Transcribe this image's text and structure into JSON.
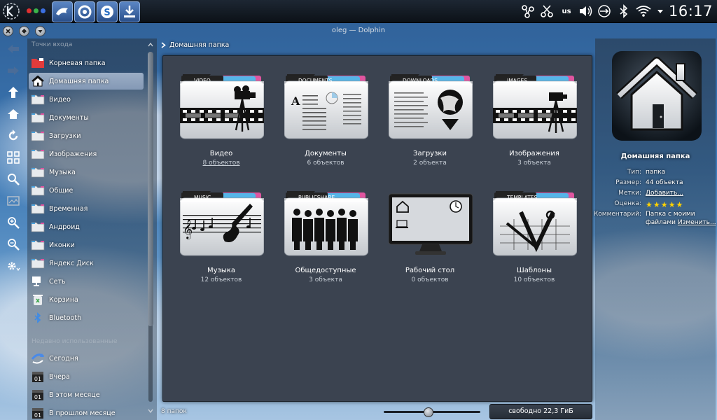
{
  "colors": {
    "accent": "#2a4f8a",
    "selected": "#a9bcd6",
    "panel": "#3b4350",
    "star": "#ffd200"
  },
  "tray": {
    "keyboard_layout": "us"
  },
  "clock": "16:17",
  "window": {
    "title": "oleg — Dolphin"
  },
  "places": {
    "header": "Точки входа",
    "items": [
      {
        "label": "Корневая папка",
        "icon": "root-folder-icon"
      },
      {
        "label": "Домашняя папка",
        "icon": "home-icon",
        "selected": true
      },
      {
        "label": "Видео",
        "icon": "video-folder-icon"
      },
      {
        "label": "Документы",
        "icon": "documents-folder-icon"
      },
      {
        "label": "Загрузки",
        "icon": "downloads-folder-icon"
      },
      {
        "label": "Изображения",
        "icon": "images-folder-icon"
      },
      {
        "label": "Музыка",
        "icon": "music-folder-icon"
      },
      {
        "label": "Общие",
        "icon": "public-folder-icon"
      },
      {
        "label": "Временная",
        "icon": "temp-folder-icon"
      },
      {
        "label": "Андроид",
        "icon": "android-folder-icon"
      },
      {
        "label": "Иконки",
        "icon": "icons-folder-icon"
      },
      {
        "label": "Яндекс Диск",
        "icon": "yandex-disk-icon"
      },
      {
        "label": "Сеть",
        "icon": "network-icon"
      },
      {
        "label": "Корзина",
        "icon": "trash-icon"
      },
      {
        "label": "Bluetooth",
        "icon": "bluetooth-icon"
      }
    ],
    "recent_header": "Недавно использованные",
    "recent": [
      {
        "label": "Сегодня",
        "icon": "today-icon"
      },
      {
        "label": "Вчера",
        "icon": "calendar-icon",
        "day": "01"
      },
      {
        "label": "В этом месяце",
        "icon": "calendar-icon",
        "day": "01"
      },
      {
        "label": "В прошлом месяце",
        "icon": "calendar-icon",
        "day": "01"
      }
    ]
  },
  "breadcrumb": {
    "label": "Домашняя папка"
  },
  "folders": [
    {
      "name": "Видео",
      "count": "8 объектов",
      "tab": "VIDEO",
      "type": "video",
      "hover": true
    },
    {
      "name": "Документы",
      "count": "6 объектов",
      "tab": "DOCUMENTS",
      "type": "documents",
      "doc_letter": "A"
    },
    {
      "name": "Загрузки",
      "count": "2 объекта",
      "tab": "DOWNLOADS",
      "type": "downloads"
    },
    {
      "name": "Изображения",
      "count": "3 объекта",
      "tab": "IMAGES",
      "type": "images"
    },
    {
      "name": "Музыка",
      "count": "12 объектов",
      "tab": "MUSIC",
      "type": "music"
    },
    {
      "name": "Общедоступные",
      "count": "3 объекта",
      "tab": "PUBLICSHARE",
      "type": "publicshare"
    },
    {
      "name": "Рабочий стол",
      "count": "0 объектов",
      "tab": "",
      "type": "desktop"
    },
    {
      "name": "Шаблоны",
      "count": "10 объектов",
      "tab": "TEMPLATES",
      "type": "templates"
    }
  ],
  "status": {
    "folders_count": "8 папок",
    "zoom_fraction": 0.45,
    "free_space": "свободно 22,3 ГиБ",
    "used_fraction": 0.0
  },
  "info": {
    "title": "Домашняя папка",
    "rows": [
      {
        "key": "Тип:",
        "value": "папка"
      },
      {
        "key": "Размер:",
        "value": "44 объекта"
      },
      {
        "key": "Метки:",
        "value": "Добавить...",
        "link": true
      },
      {
        "key": "Оценка:",
        "stars": 5
      },
      {
        "key": "Комментарий:",
        "value": "Папка с моими",
        "value2": "файлами",
        "link2": "Изменить..."
      }
    ]
  }
}
